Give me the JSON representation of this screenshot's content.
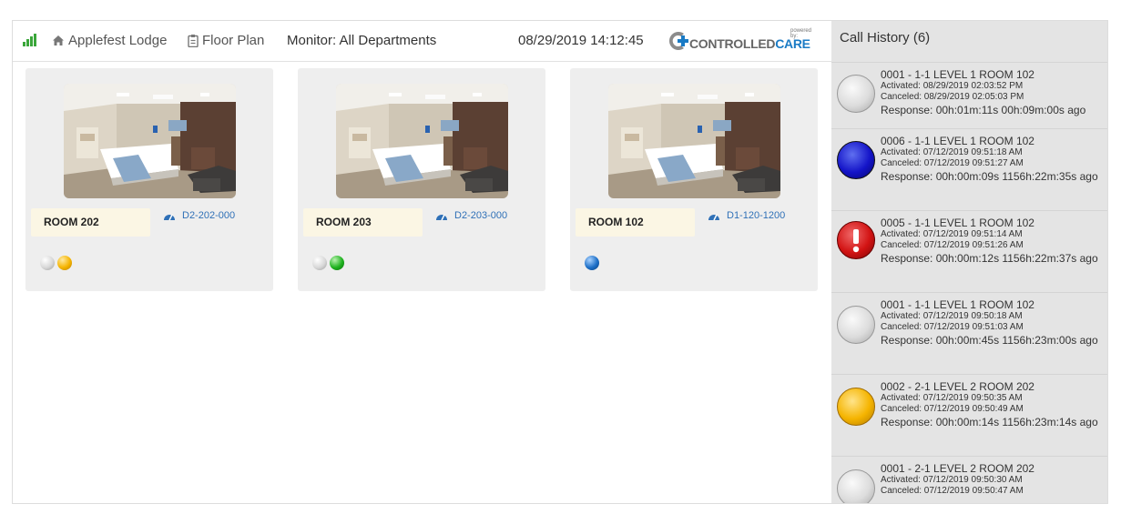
{
  "header": {
    "facility": "Applefest Lodge",
    "floor_plan": "Floor Plan",
    "monitor": "Monitor: All Departments",
    "datetime": "08/29/2019 14:12:45",
    "logo": {
      "text_a": "CONTROLLED",
      "text_b": "CARE",
      "powered": "powered by:"
    }
  },
  "rooms": [
    {
      "name": "ROOM 202",
      "device": "D2-202-000",
      "status_colors": [
        "#d8d8d8",
        "#f5b400"
      ]
    },
    {
      "name": "ROOM 203",
      "device": "D2-203-000",
      "status_colors": [
        "#d8d8d8",
        "#1fb21f"
      ]
    },
    {
      "name": "ROOM 102",
      "device": "D1-120-1200",
      "status_colors": [
        "#1d6fc7"
      ]
    }
  ],
  "call_history": {
    "title": "Call History (6)",
    "items": [
      {
        "title": "0001 - 1-1 LEVEL 1 ROOM 102",
        "activated": "Activated: 08/29/2019 02:03:52 PM",
        "canceled": "Canceled: 08/29/2019 02:05:03 PM",
        "response": "Response: 00h:01m:11s 00h:09m:00s ago",
        "icon": "gray-circle-icon"
      },
      {
        "title": "0006 - 1-1 LEVEL 1 ROOM 102",
        "activated": "Activated: 07/12/2019 09:51:18 AM",
        "canceled": "Canceled: 07/12/2019 09:51:27 AM",
        "response": "Response: 00h:00m:09s 1156h:22m:35s ago",
        "icon": "blue-circle-icon"
      },
      {
        "title": "0005 - 1-1 LEVEL 1 ROOM 102",
        "activated": "Activated: 07/12/2019 09:51:14 AM",
        "canceled": "Canceled: 07/12/2019 09:51:26 AM",
        "response": "Response: 00h:00m:12s 1156h:22m:37s ago",
        "icon": "red-alert-icon"
      },
      {
        "title": "0001 - 1-1 LEVEL 1 ROOM 102",
        "activated": "Activated: 07/12/2019 09:50:18 AM",
        "canceled": "Canceled: 07/12/2019 09:51:03 AM",
        "response": "Response: 00h:00m:45s 1156h:23m:00s ago",
        "icon": "gray-circle-icon"
      },
      {
        "title": "0002 - 2-1 LEVEL 2 ROOM 202",
        "activated": "Activated: 07/12/2019 09:50:35 AM",
        "canceled": "Canceled: 07/12/2019 09:50:49 AM",
        "response": "Response: 00h:00m:14s 1156h:23m:14s ago",
        "icon": "yellow-circle-icon"
      },
      {
        "title": "0001 - 2-1 LEVEL 2 ROOM 202",
        "activated": "Activated: 07/12/2019 09:50:30 AM",
        "canceled": "Canceled: 07/12/2019 09:50:47 AM",
        "response": "",
        "icon": "gray-circle-icon"
      }
    ]
  },
  "colors": {
    "accent_blue": "#2f70b7",
    "card_bg": "#eeeeee",
    "room_label_bg": "#fbf6e4",
    "sidebar_bg": "#e4e4e4"
  }
}
